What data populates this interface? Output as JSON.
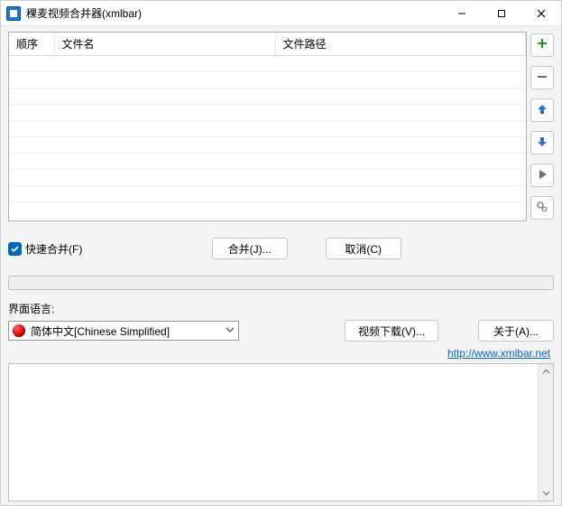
{
  "title": "稞麦视频合并器(xmlbar)",
  "columns": {
    "order": "顺序",
    "name": "文件名",
    "path": "文件路径"
  },
  "rows": [],
  "tools": {
    "add": "add",
    "remove": "remove",
    "up": "up",
    "down": "down",
    "play": "play",
    "settings": "settings"
  },
  "checkbox": {
    "label": "快速合并(F)",
    "checked": true
  },
  "buttons": {
    "merge": "合并(J)...",
    "cancel": "取消(C)",
    "download": "视频下载(V)...",
    "about": "关于(A)..."
  },
  "language": {
    "label": "界面语言:",
    "selected": "简体中文[Chinese Simplified]"
  },
  "link": {
    "text": "http://www.xmlbar.net"
  },
  "colors": {
    "accent": "#0067c0",
    "add_green": "#1aa01a",
    "arrow_blue": "#2f6fd0",
    "play_gray": "#6d6d6d"
  }
}
